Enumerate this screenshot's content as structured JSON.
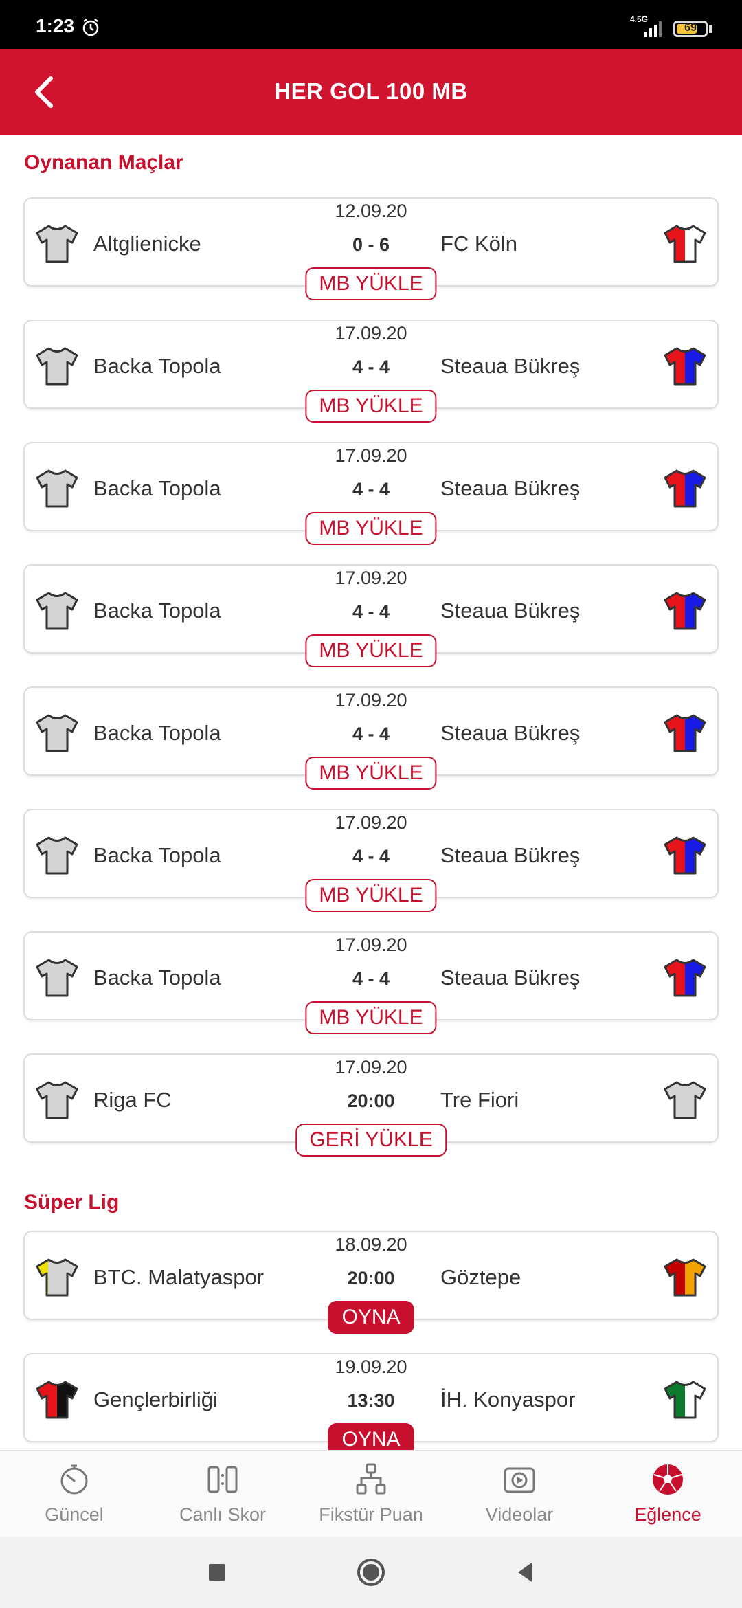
{
  "status_bar": {
    "time": "1:23",
    "network": "4.5G",
    "battery": "69"
  },
  "header": {
    "title": "HER GOL 100 MB"
  },
  "sections": [
    {
      "title": "Oynanan Maçlar",
      "matches": [
        {
          "date": "12.09.20",
          "home": "Altglienicke",
          "score": "0 - 6",
          "away": "FC Köln",
          "action": "MB YÜKLE"
        },
        {
          "date": "17.09.20",
          "home": "Backa Topola",
          "score": "4 - 4",
          "away": "Steaua Bükreş",
          "action": "MB YÜKLE"
        },
        {
          "date": "17.09.20",
          "home": "Backa Topola",
          "score": "4 - 4",
          "away": "Steaua Bükreş",
          "action": "MB YÜKLE"
        },
        {
          "date": "17.09.20",
          "home": "Backa Topola",
          "score": "4 - 4",
          "away": "Steaua Bükreş",
          "action": "MB YÜKLE"
        },
        {
          "date": "17.09.20",
          "home": "Backa Topola",
          "score": "4 - 4",
          "away": "Steaua Bükreş",
          "action": "MB YÜKLE"
        },
        {
          "date": "17.09.20",
          "home": "Backa Topola",
          "score": "4 - 4",
          "away": "Steaua Bükreş",
          "action": "MB YÜKLE"
        },
        {
          "date": "17.09.20",
          "home": "Backa Topola",
          "score": "4 - 4",
          "away": "Steaua Bükreş",
          "action": "MB YÜKLE"
        },
        {
          "date": "17.09.20",
          "home": "Riga FC",
          "score": "20:00",
          "away": "Tre Fiori",
          "action": "GERİ YÜKLE"
        }
      ]
    },
    {
      "title": "Süper Lig",
      "matches": [
        {
          "date": "18.09.20",
          "home": "BTC. Malatyaspor",
          "score": "20:00",
          "away": "Göztepe",
          "action": "OYNA"
        },
        {
          "date": "19.09.20",
          "home": "Gençlerbirliği",
          "score": "13:30",
          "away": "İH. Konyaspor",
          "action": "OYNA"
        }
      ]
    }
  ],
  "bottom_nav": [
    {
      "label": "Güncel",
      "icon": "stopwatch-icon"
    },
    {
      "label": "Canlı Skor",
      "icon": "live-score-icon"
    },
    {
      "label": "Fikstür Puan",
      "icon": "fixture-icon"
    },
    {
      "label": "Videolar",
      "icon": "video-play-icon"
    },
    {
      "label": "Eğlence",
      "icon": "soccer-ball-icon",
      "active": true
    }
  ],
  "colors": {
    "brand_red": "#d0142f",
    "jersey_grey": "#d4d4d4",
    "red": "#e8141b",
    "blue": "#1a1ae6",
    "yellow": "#f0e000",
    "black": "#111111",
    "orange": "#f5a300",
    "dark_red": "#c20000",
    "green": "#0e7a2e",
    "white": "#ffffff"
  }
}
